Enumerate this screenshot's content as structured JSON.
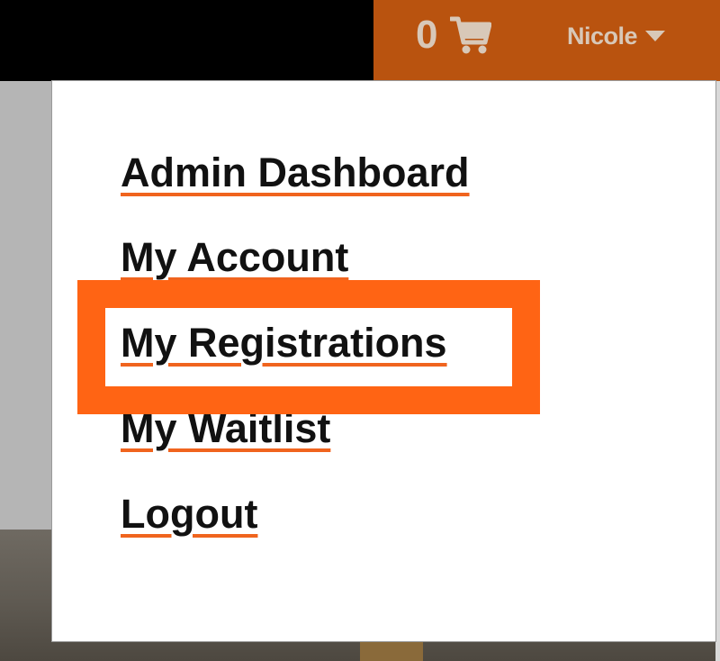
{
  "header": {
    "cart": {
      "count": "0",
      "icon": "cart-icon"
    },
    "user": {
      "name": "Nicole",
      "icon": "caret-down-icon"
    }
  },
  "user_menu": {
    "items": [
      {
        "label": "Admin Dashboard"
      },
      {
        "label": "My Account"
      },
      {
        "label": "My Registrations",
        "highlighted": true
      },
      {
        "label": "My Waitlist"
      },
      {
        "label": "Logout"
      }
    ]
  },
  "colors": {
    "topbar": "#000000",
    "user_area": "#b9530f",
    "accent_underline": "#f0641e",
    "highlight": "#ff6414",
    "header_text": "#d8c8b8",
    "menu_text": "#111111"
  }
}
